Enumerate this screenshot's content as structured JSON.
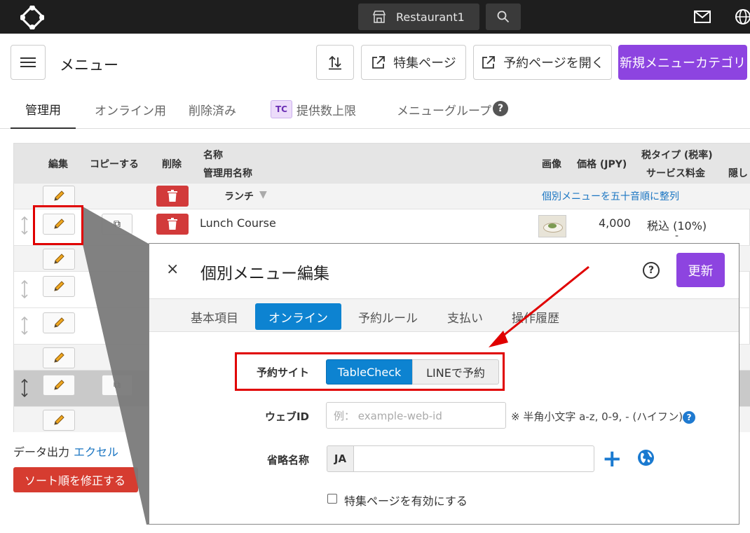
{
  "topbar": {
    "venue": "Restaurant1"
  },
  "header": {
    "title": "メニュー",
    "special_page_label": "特集ページ",
    "open_booking_label": "予約ページを開く",
    "new_category_label": "新規メニューカテゴリ"
  },
  "tabs": [
    {
      "label": "管理用"
    },
    {
      "label": "オンライン用"
    },
    {
      "label": "削除済み"
    },
    {
      "badge": "TC",
      "label": "提供数上限"
    },
    {
      "label": "メニューグループ"
    }
  ],
  "help_glyph": "?",
  "table": {
    "headers": {
      "edit": "編集",
      "copy": "コピーする",
      "delete": "削除",
      "name": "名称",
      "admin_name": "管理用名称",
      "image": "画像",
      "price": "価格 (JPY)",
      "tax_type": "税タイプ (税率)",
      "service_fee": "サービス料金",
      "hidden_partial": "隠し"
    },
    "category_row": {
      "name": "ランチ",
      "sort_link": "個別メニューを五十音順に整列"
    },
    "item_row": {
      "name": "Lunch Course",
      "price": "4,000",
      "tax": "税込 (10%)",
      "service": "-"
    }
  },
  "footer": {
    "data_output_label": "データ出力",
    "excel_link": "エクセル",
    "fix_sort_label": "ソート順を修正する"
  },
  "modal": {
    "close": "×",
    "title": "個別メニュー編集",
    "help": "?",
    "update_label": "更新",
    "tabs": [
      "基本項目",
      "オンライン",
      "予約ルール",
      "支払い",
      "操作履歴"
    ],
    "booking_site_label": "予約サイト",
    "booking_options": [
      "TableCheck",
      "LINEで予約"
    ],
    "web_id_label": "ウェブID",
    "web_id_placeholder": "例： example-web-id",
    "web_id_hint": "※ 半角小文字 a-z, 0-9, - (ハイフン)",
    "abbr_label": "省略名称",
    "lang": "JA",
    "enable_special_label": "特集ページを有効にする"
  },
  "colors": {
    "purple": "#8d44e0",
    "blue": "#0d83d1",
    "red_highlight": "#e00000",
    "delete_red": "#d23a3a"
  }
}
